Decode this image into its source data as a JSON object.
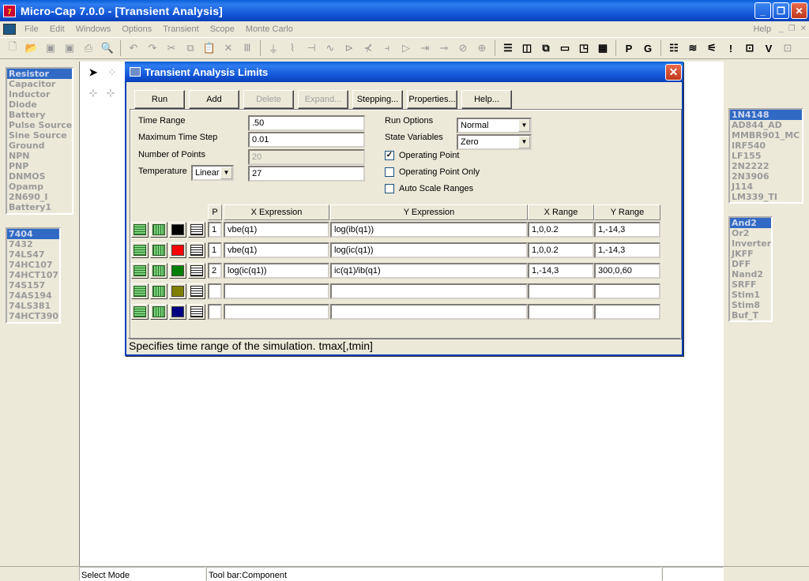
{
  "window": {
    "title": "Micro-Cap 7.0.0 - [Transient Analysis]",
    "app_icon": "7"
  },
  "menu": [
    "File",
    "Edit",
    "Windows",
    "Options",
    "Transient",
    "Scope",
    "Monte Carlo"
  ],
  "menu_right": "Help",
  "component_list": [
    "Resistor",
    "Capacitor",
    "Inductor",
    "Diode",
    "Battery",
    "Pulse Source",
    "Sine Source",
    "Ground",
    "NPN",
    "PNP",
    "DNMOS",
    "Opamp",
    "2N690_I",
    "Battery1"
  ],
  "ttl_list": [
    "7404",
    "7432",
    "74LS47",
    "74HC107",
    "74HCT107",
    "74S157",
    "74AS194",
    "74LS381",
    "74HCT390"
  ],
  "part_list": [
    "1N4148",
    "AD844_AD",
    "MMBR901_MC",
    "IRF540",
    "LF155",
    "2N2222",
    "2N3906",
    "J114",
    "LM339_TI"
  ],
  "gate_list": [
    "And2",
    "Or2",
    "Inverter",
    "JKFF",
    "DFF",
    "Nand2",
    "SRFF",
    "Stim1",
    "Stim8",
    "Buf_T"
  ],
  "toolbar_text": {
    "p": "P",
    "g": "G"
  },
  "dialog": {
    "title": "Transient Analysis Limits",
    "buttons": {
      "run": "Run",
      "add": "Add",
      "delete": "Delete",
      "expand": "Expand...",
      "stepping": "Stepping...",
      "properties": "Properties...",
      "help": "Help..."
    },
    "time_range_label": "Time Range",
    "time_range": ".50",
    "max_step_label": "Maximum Time Step",
    "max_step": "0.01",
    "num_points_label": "Number of Points",
    "num_points": "20",
    "temperature_label": "Temperature",
    "temperature_mode": "Linear",
    "temperature": "27",
    "run_options_label": "Run Options",
    "run_options": "Normal",
    "state_vars_label": "State Variables",
    "state_vars": "Zero",
    "operating_point_label": "Operating Point",
    "operating_point_only_label": "Operating Point Only",
    "auto_scale_label": "Auto Scale Ranges",
    "checks": {
      "operating_point": true,
      "operating_point_only": false,
      "auto_scale": false
    },
    "headers": {
      "p": "P",
      "x": "X Expression",
      "y": "Y Expression",
      "xr": "X Range",
      "yr": "Y Range"
    },
    "rows": [
      {
        "p": "1",
        "x": "vbe(q1)",
        "y": "log(ib(q1))",
        "xr": "1,0,0.2",
        "yr": "1,-14,3",
        "color": "#000000"
      },
      {
        "p": "1",
        "x": "vbe(q1)",
        "y": "log(ic(q1))",
        "xr": "1,0,0.2",
        "yr": "1,-14,3",
        "color": "#ff0000"
      },
      {
        "p": "2",
        "x": "log(ic(q1))",
        "y": "ic(q1)/ib(q1)",
        "xr": "1,-14,3",
        "yr": "300,0,60",
        "color": "#008000"
      },
      {
        "p": "",
        "x": "",
        "y": "",
        "xr": "",
        "yr": "",
        "color": "#808000"
      },
      {
        "p": "",
        "x": "",
        "y": "",
        "xr": "",
        "yr": "",
        "color": "#000080"
      }
    ],
    "hint": "Specifies time range of the simulation. tmax[,tmin]"
  },
  "status": {
    "mode": "Select Mode",
    "toolbar": "Tool bar:Component"
  }
}
